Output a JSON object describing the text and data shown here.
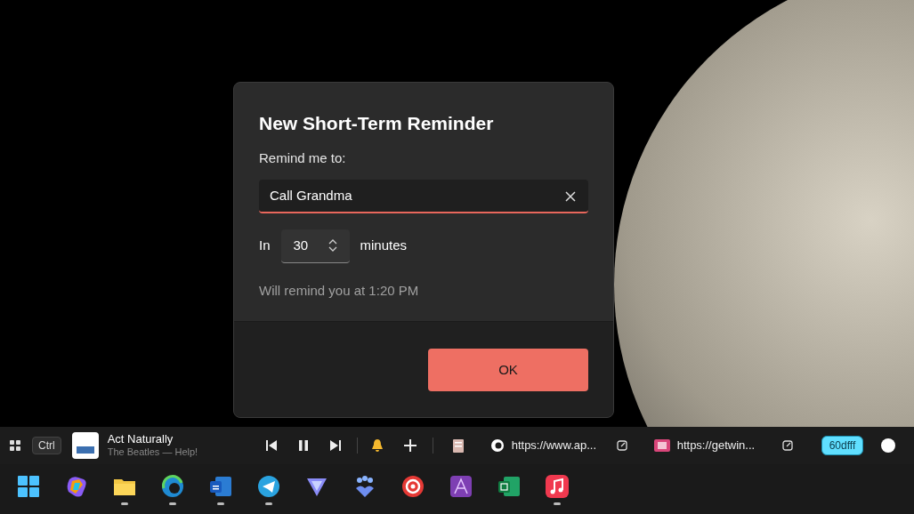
{
  "dialog": {
    "title": "New Short-Term Reminder",
    "field_label": "Remind me to:",
    "reminder_field": {
      "value": "Call Grandma"
    },
    "prefix": "In",
    "minutes": {
      "value": "30"
    },
    "unit": "minutes",
    "summary": "Will remind you at 1:20 PM",
    "ok_button": "OK"
  },
  "toolbar": {
    "modifier_key": "Ctrl",
    "now_playing": {
      "title": "Act Naturally",
      "subtitle": "The Beatles — Help!",
      "playing": true
    },
    "tabs": [
      {
        "kind": "round",
        "url": "https://www.ap..."
      },
      {
        "kind": "square",
        "url": "https://getwin..."
      }
    ],
    "color_badge": {
      "label": "60dfff",
      "color": "#60dfff"
    }
  },
  "taskbar": {
    "apps": [
      {
        "kind": "start",
        "running": false
      },
      {
        "kind": "copilot",
        "running": false
      },
      {
        "kind": "folder",
        "running": true
      },
      {
        "kind": "edge",
        "running": true
      },
      {
        "kind": "word",
        "running": true
      },
      {
        "kind": "telegram",
        "running": true
      },
      {
        "kind": "triangle",
        "running": false
      },
      {
        "kind": "people",
        "running": false
      },
      {
        "kind": "podcast",
        "running": false
      },
      {
        "kind": "affinity",
        "running": false
      },
      {
        "kind": "excel",
        "running": false
      },
      {
        "kind": "music",
        "running": true
      }
    ]
  }
}
